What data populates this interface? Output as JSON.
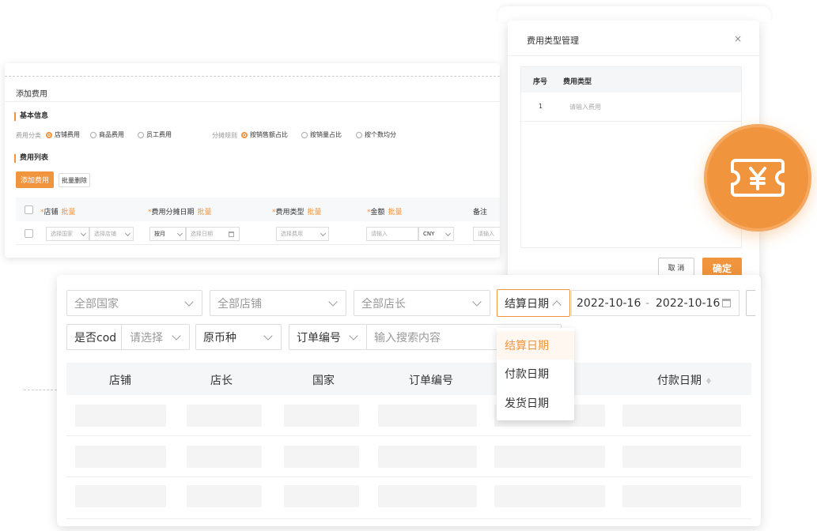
{
  "add_fee": {
    "title": "添加费用",
    "basic_info": "基本信息",
    "fee_category_label": "费用分类",
    "fee_category_options": [
      "店铺费用",
      "商品费用",
      "员工费用"
    ],
    "allocation_label": "分摊规则",
    "allocation_options": [
      "按销售额占比",
      "按销量占比",
      "按个数均分"
    ],
    "fee_list": "费用列表",
    "add_button": "添加费用",
    "bulk_delete_button": "批量删除",
    "columns": [
      "店铺",
      "费用分摊日期",
      "费用类型",
      "金额",
      "备注"
    ],
    "bulk_label": "批量",
    "row": {
      "country_placeholder": "选择国家",
      "store_placeholder": "选择店铺",
      "by_month": "按月",
      "date_placeholder": "选择日期",
      "fee_type_placeholder": "选择费用",
      "amount_placeholder": "请输入",
      "currency": "CNY",
      "note_placeholder": "请输入"
    }
  },
  "fee_type_dialog": {
    "title": "费用类型管理",
    "close_glyph": "×",
    "col_index": "序号",
    "col_type": "费用类型",
    "row_index": "1",
    "row_placeholder": "请输入费用",
    "cancel_button": "取 消",
    "ok_button": "确定"
  },
  "filters": {
    "country": "全部国家",
    "store": "全部店铺",
    "manager": "全部店长",
    "date_type": "结算日期",
    "date_start": "2022-10-16",
    "date_sep": "-",
    "date_end": "2022-10-16",
    "cod_label": "是否cod",
    "cod_placeholder": "请选择",
    "currency": "原币种",
    "order_field": "订单编号",
    "search_placeholder": "输入搜索内容"
  },
  "date_type_options": [
    "结算日期",
    "付款日期",
    "发货日期"
  ],
  "table": {
    "columns": [
      "店铺",
      "店长",
      "国家",
      "订单编号",
      "付款日期"
    ]
  },
  "colors": {
    "accent": "#f0953d"
  }
}
